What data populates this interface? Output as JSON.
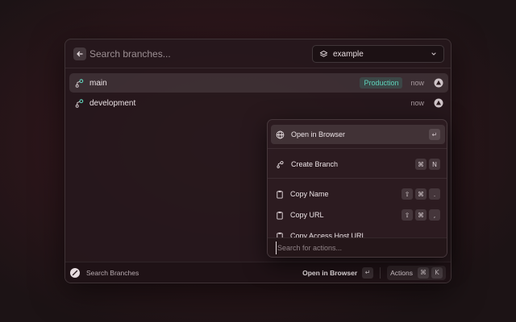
{
  "search": {
    "placeholder": "Search branches..."
  },
  "project_selector": {
    "value": "example"
  },
  "branches": [
    {
      "name": "main",
      "badge": "Production",
      "time": "now"
    },
    {
      "name": "development",
      "badge": "",
      "time": "now"
    }
  ],
  "actions_menu": {
    "items": [
      {
        "label": "Open in Browser",
        "keys": [
          "↵"
        ]
      },
      {
        "label": "Create Branch",
        "keys": [
          "⌘",
          "N"
        ]
      },
      {
        "label": "Copy Name",
        "keys": [
          "⇧",
          "⌘",
          "."
        ]
      },
      {
        "label": "Copy URL",
        "keys": [
          "⇧",
          "⌘",
          ","
        ]
      },
      {
        "label": "Copy Access Host URL",
        "keys": []
      }
    ],
    "search_placeholder": "Search for actions..."
  },
  "footer": {
    "title": "Search Branches",
    "primary_action": "Open in Browser",
    "primary_key": "↵",
    "actions_label": "Actions",
    "actions_keys": [
      "⌘",
      "K"
    ]
  },
  "colors": {
    "accent": "#5fd3bb",
    "background": "#2e161b"
  },
  "icons": {
    "back": "arrow-left-icon",
    "project": "layers-icon",
    "branch": "git-branch-icon",
    "avatar": "vercel-avatar-icon",
    "globe": "globe-icon",
    "clipboard": "clipboard-icon"
  }
}
